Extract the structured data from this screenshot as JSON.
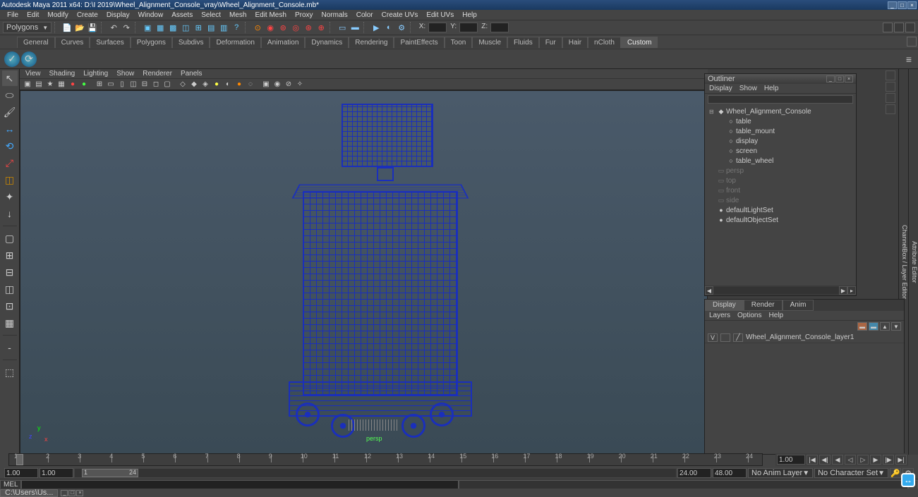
{
  "title": "Autodesk Maya 2011 x64: D:\\I 2019\\Wheel_Alignment_Console_vray\\Wheel_Alignment_Console.mb*",
  "menu": [
    "File",
    "Edit",
    "Modify",
    "Create",
    "Display",
    "Window",
    "Assets",
    "Select",
    "Mesh",
    "Edit Mesh",
    "Proxy",
    "Normals",
    "Color",
    "Create UVs",
    "Edit UVs",
    "Help"
  ],
  "status": {
    "mode": "Polygons",
    "coord_labels": [
      "X:",
      "Y:",
      "Z:"
    ]
  },
  "shelf_tabs": [
    "General",
    "Curves",
    "Surfaces",
    "Polygons",
    "Subdivs",
    "Deformation",
    "Animation",
    "Dynamics",
    "Rendering",
    "PaintEffects",
    "Toon",
    "Muscle",
    "Fluids",
    "Fur",
    "Hair",
    "nCloth",
    "Custom"
  ],
  "shelf_active": "Custom",
  "vp_menu": [
    "View",
    "Shading",
    "Lighting",
    "Show",
    "Renderer",
    "Panels"
  ],
  "viewport_label": "persp",
  "axis": {
    "x": "x",
    "y": "y",
    "z": "z"
  },
  "outliner": {
    "title": "Outliner",
    "menu": [
      "Display",
      "Show",
      "Help"
    ],
    "items": [
      {
        "lv": 0,
        "name": "Wheel_Alignment_Console",
        "ic": "◆",
        "exp": "⊟"
      },
      {
        "lv": 1,
        "name": "table",
        "ic": "○"
      },
      {
        "lv": 1,
        "name": "table_mount",
        "ic": "○"
      },
      {
        "lv": 1,
        "name": "display",
        "ic": "○"
      },
      {
        "lv": 1,
        "name": "screen",
        "ic": "○"
      },
      {
        "lv": 1,
        "name": "table_wheel",
        "ic": "○"
      },
      {
        "lv": 0,
        "name": "persp",
        "ic": "▭",
        "dim": true
      },
      {
        "lv": 0,
        "name": "top",
        "ic": "▭",
        "dim": true
      },
      {
        "lv": 0,
        "name": "front",
        "ic": "▭",
        "dim": true
      },
      {
        "lv": 0,
        "name": "side",
        "ic": "▭",
        "dim": true
      },
      {
        "lv": 0,
        "name": "defaultLightSet",
        "ic": "●"
      },
      {
        "lv": 0,
        "name": "defaultObjectSet",
        "ic": "●"
      }
    ]
  },
  "layer_tabs": [
    "Display",
    "Render",
    "Anim"
  ],
  "layer_active": "Display",
  "layer_menu": [
    "Layers",
    "Options",
    "Help"
  ],
  "layers": [
    {
      "v": "V",
      "name": "Wheel_Alignment_Console_layer1"
    }
  ],
  "timeline": {
    "start": 1,
    "end": 24,
    "majors": [
      1,
      2,
      3,
      4,
      5,
      6,
      7,
      8,
      9,
      10,
      11,
      12,
      13,
      14,
      15,
      16,
      17,
      18,
      19,
      20,
      21,
      22,
      23,
      24
    ]
  },
  "play_end": "1.00",
  "range": {
    "start": "1.00",
    "inner_start": "1.00",
    "inner_start2": "1",
    "inner_end": "24",
    "end": "24.00",
    "full_end": "48.00",
    "anim_layer": "No Anim Layer",
    "char_set": "No Character Set"
  },
  "cmd_lang": "MEL",
  "taskbar_item": "C:\\Users\\Us..."
}
